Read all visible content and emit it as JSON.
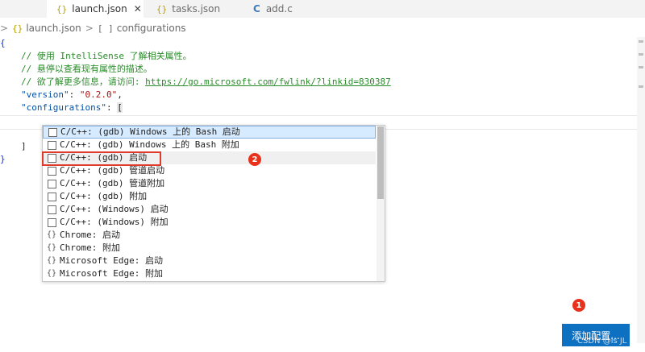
{
  "tabs": [
    {
      "label": "launch.json",
      "icon": "{}",
      "close": "✕"
    },
    {
      "label": "tasks.json",
      "icon": "{}"
    },
    {
      "label": "add.c",
      "icon": "C"
    }
  ],
  "breadcrumb": {
    "file": "launch.json",
    "file_icon": "{}",
    "section": "configurations",
    "section_icon": "[ ]"
  },
  "editor": {
    "open_brace": "{",
    "comment1": "// 使用 IntelliSense 了解相关属性。",
    "comment2": "// 悬停以查看现有属性的描述。",
    "comment3_prefix": "// 欲了解更多信息，请访问: ",
    "comment3_link": "https://go.microsoft.com/fwlink/?linkid=830387",
    "version_key": "\"version\"",
    "version_colon": ": ",
    "version_value": "\"0.2.0\"",
    "version_comma": ",",
    "config_key": "\"configurations\"",
    "config_colon": ": ",
    "config_open": "[",
    "config_close": "]",
    "close_brace": "}"
  },
  "suggestions": [
    {
      "icon": "box",
      "text": "C/C++: (gdb) Windows 上的 Bash 启动"
    },
    {
      "icon": "box",
      "text": "C/C++: (gdb) Windows 上的 Bash 附加"
    },
    {
      "icon": "box",
      "text": "C/C++: (gdb) 启动"
    },
    {
      "icon": "box",
      "text": "C/C++: (gdb) 管道启动"
    },
    {
      "icon": "box",
      "text": "C/C++: (gdb) 管道附加"
    },
    {
      "icon": "box",
      "text": "C/C++: (gdb) 附加"
    },
    {
      "icon": "box",
      "text": "C/C++: (Windows) 启动"
    },
    {
      "icon": "box",
      "text": "C/C++: (Windows) 附加"
    },
    {
      "icon": "braces",
      "text": "Chrome: 启动"
    },
    {
      "icon": "braces",
      "text": "Chrome: 附加"
    },
    {
      "icon": "braces",
      "text": "Microsoft Edge: 启动"
    },
    {
      "icon": "braces",
      "text": "Microsoft Edge: 附加"
    }
  ],
  "annotations": {
    "badge1": "1",
    "badge2": "2"
  },
  "add_button_label": "添加配置...",
  "watermark": "CSDN @is JL",
  "colors": {
    "accent": "#0e70c0",
    "annotation": "#e8321b",
    "selection": "#d6ebff"
  }
}
